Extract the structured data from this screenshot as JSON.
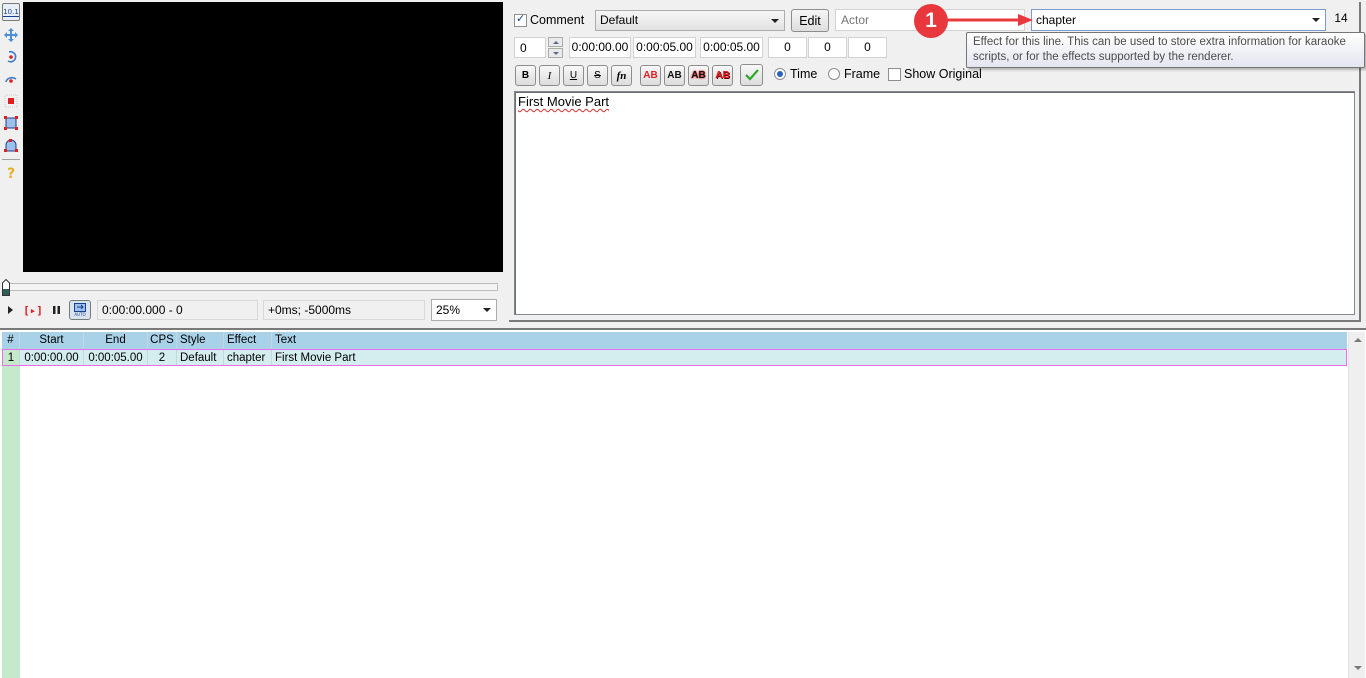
{
  "video_toolbar": {
    "items": [
      {
        "icon": "realtime-position-icon",
        "label": "10.1",
        "selected": true
      },
      {
        "icon": "drag-move-icon"
      },
      {
        "icon": "rotate-z-icon"
      },
      {
        "icon": "rotate-xy-icon"
      },
      {
        "icon": "scale-icon"
      },
      {
        "icon": "clip-rect-icon"
      },
      {
        "icon": "vector-clip-icon"
      },
      {
        "icon": "help-icon",
        "label": "?"
      }
    ]
  },
  "video_controls": {
    "time_display": "0:00:00.000 - 0",
    "offset_display": "+0ms; -5000ms",
    "zoom": "25%",
    "auto_label": "AUTO"
  },
  "edit_box": {
    "comment_label": "Comment",
    "comment_checked": true,
    "style_value": "Default",
    "edit_button": "Edit",
    "actor_placeholder": "Actor",
    "effect_value": "chapter",
    "char_count": "14",
    "layer": "0",
    "start_time": "0:00:00.00",
    "end_time": "0:00:05.00",
    "duration": "0:00:05.00",
    "margin_left": "0",
    "margin_right": "0",
    "margin_vert": "0",
    "format_buttons": [
      "B",
      "I",
      "U",
      "S",
      "fn"
    ],
    "color_buttons": [
      "AB",
      "AB",
      "AB",
      "AB"
    ],
    "commit_icon": "checkmark-icon",
    "time_label": "Time",
    "frame_label": "Frame",
    "time_mode": "Time",
    "show_original_label": "Show Original",
    "show_original_checked": false,
    "text": "First Movie Part"
  },
  "tooltip": {
    "line1": "Effect for this line. This can be used to store extra information for karaoke",
    "line2": "scripts, or for the effects supported by the renderer."
  },
  "annotation": {
    "badge": "1",
    "color": "#e8383d"
  },
  "grid": {
    "columns": [
      "#",
      "Start",
      "End",
      "CPS",
      "Style",
      "Effect",
      "Text"
    ],
    "rows": [
      {
        "num": "1",
        "start": "0:00:00.00",
        "end": "0:00:05.00",
        "cps": "2",
        "style": "Default",
        "effect": "chapter",
        "text": "First Movie Part"
      }
    ]
  }
}
